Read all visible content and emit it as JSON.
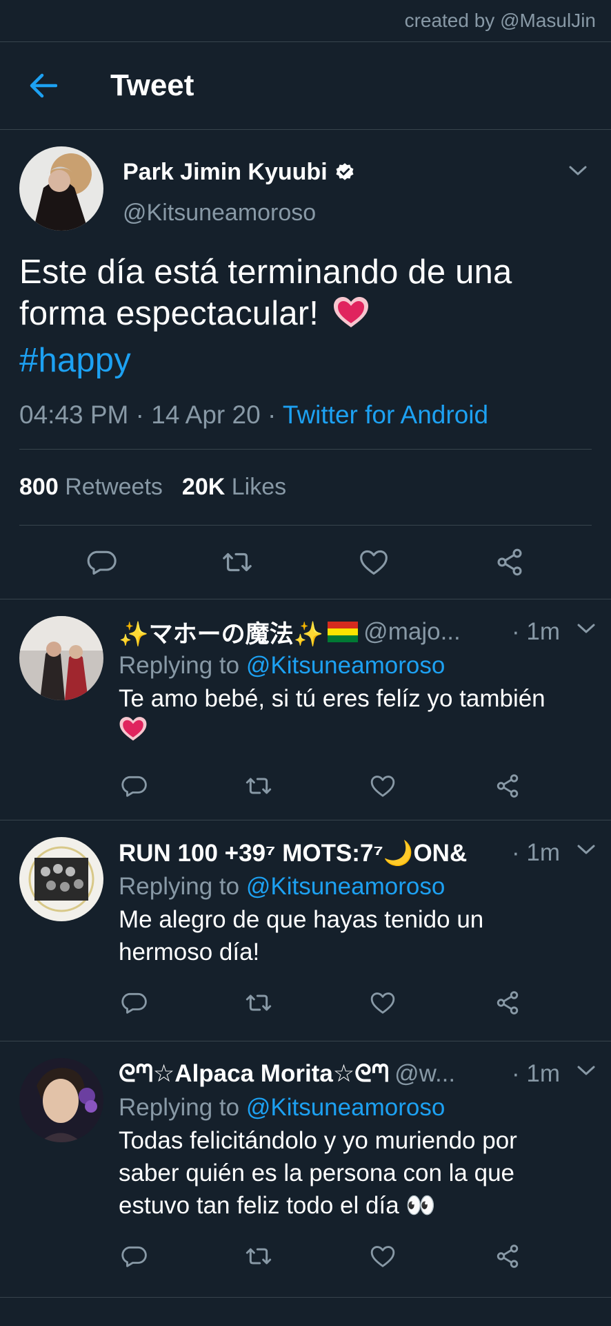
{
  "watermark": "created by @MasulJin",
  "header": {
    "title": "Tweet"
  },
  "tweet": {
    "author_name": "Park Jimin Kyuubi",
    "author_handle": "@Kitsuneamoroso",
    "text_line1": "Este día está terminando de una",
    "text_line2": "forma espectacular!",
    "hashtag": "#happy",
    "time": "04:43 PM",
    "date": "14 Apr 20",
    "source": "Twitter for Android",
    "retweets_count": "800",
    "retweets_label": "Retweets",
    "likes_count": "20K",
    "likes_label": "Likes"
  },
  "replying_label": "Replying to",
  "replies": [
    {
      "name": "✨マホーの魔法✨",
      "handle": "@majo...",
      "time": "· 1m",
      "replying_to": "@Kitsuneamoroso",
      "text_line1": "Te amo bebé, si tú eres felíz yo también",
      "text_line2": ""
    },
    {
      "name": "RUN 100 +39⁷ MOTS:7⁷🌙ON&",
      "handle": "",
      "time": "· 1m",
      "replying_to": "@Kitsuneamoroso",
      "text_line1": "Me alegro de que hayas tenido un",
      "text_line2": "hermoso día!"
    },
    {
      "name": "ᘓᘉ☆Alpaca Morita☆ᘓᘉ",
      "handle": "@w...",
      "time": "· 1m",
      "replying_to": "@Kitsuneamoroso",
      "text_line1": "Todas felicitándolo y yo muriendo por",
      "text_line2": "saber quién es la persona con la que",
      "text_line3": "estuvo tan feliz todo el día 👀"
    }
  ],
  "colors": {
    "background": "#15202b",
    "accent": "#1da1f2",
    "muted": "#8899a6",
    "divider": "#38444d"
  }
}
